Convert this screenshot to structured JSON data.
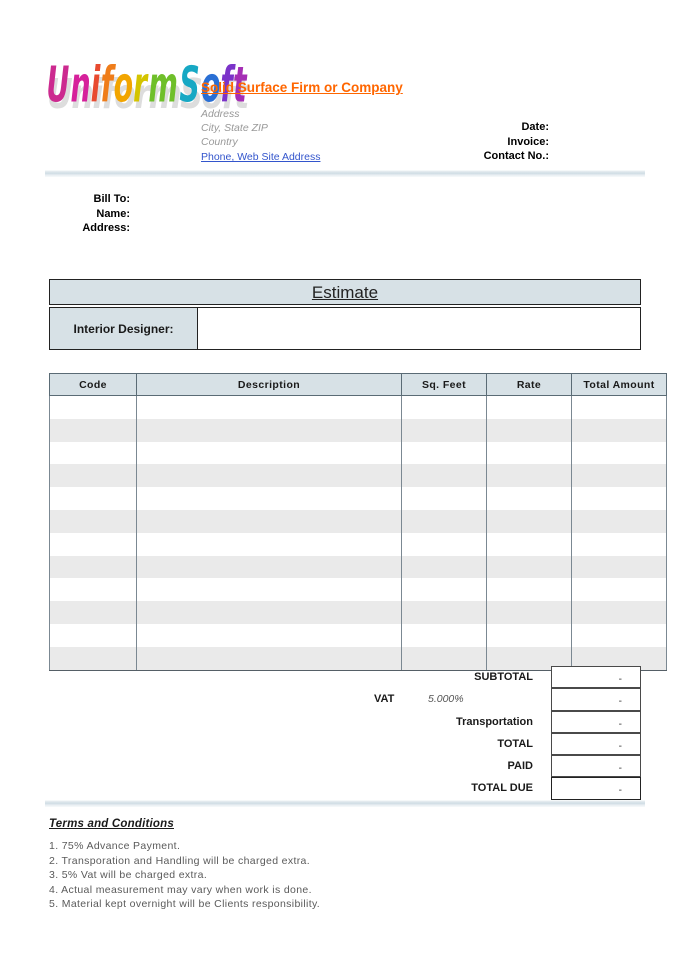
{
  "header": {
    "logo_text": "UniformSoft",
    "logo_letters": [
      {
        "ch": "U",
        "color": "#cc2a8f"
      },
      {
        "ch": "n",
        "color": "#d6219b"
      },
      {
        "ch": "i",
        "color": "#e84a2f"
      },
      {
        "ch": "f",
        "color": "#ef7d1a"
      },
      {
        "ch": "o",
        "color": "#f2a500"
      },
      {
        "ch": "r",
        "color": "#d4c400"
      },
      {
        "ch": "m",
        "color": "#6fbf2a"
      },
      {
        "ch": "S",
        "color": "#17a8c4"
      },
      {
        "ch": "o",
        "color": "#2a6fd4"
      },
      {
        "ch": "f",
        "color": "#7b33c9"
      },
      {
        "ch": "t",
        "color": "#a52fb5"
      }
    ],
    "company_name": "Solid Surface Firm or Company",
    "address_line1": "Address",
    "address_line2": "City, State ZIP",
    "address_line3": "Country",
    "address_line4": "Phone, Web Site Address",
    "meta": {
      "date_label": "Date:",
      "invoice_label": "Invoice:",
      "contact_label": "Contact No.:"
    },
    "company_name_color": "#FF6600",
    "link_color": "#3355cc"
  },
  "bill_to": {
    "title": "Bill To:",
    "name_label": "Name:",
    "address_label": "Address:"
  },
  "estimate": {
    "title": "Estimate",
    "designer_label": "Interior Designer:",
    "designer_value": ""
  },
  "items_table": {
    "columns": [
      "Code",
      "Description",
      "Sq. Feet",
      "Rate",
      "Total Amount"
    ],
    "rows": [
      {
        "code": "",
        "description": "",
        "sq_feet": "",
        "rate": "",
        "total_amount": ""
      },
      {
        "code": "",
        "description": "",
        "sq_feet": "",
        "rate": "",
        "total_amount": ""
      },
      {
        "code": "",
        "description": "",
        "sq_feet": "",
        "rate": "",
        "total_amount": ""
      },
      {
        "code": "",
        "description": "",
        "sq_feet": "",
        "rate": "",
        "total_amount": ""
      },
      {
        "code": "",
        "description": "",
        "sq_feet": "",
        "rate": "",
        "total_amount": ""
      },
      {
        "code": "",
        "description": "",
        "sq_feet": "",
        "rate": "",
        "total_amount": ""
      },
      {
        "code": "",
        "description": "",
        "sq_feet": "",
        "rate": "",
        "total_amount": ""
      },
      {
        "code": "",
        "description": "",
        "sq_feet": "",
        "rate": "",
        "total_amount": ""
      },
      {
        "code": "",
        "description": "",
        "sq_feet": "",
        "rate": "",
        "total_amount": ""
      },
      {
        "code": "",
        "description": "",
        "sq_feet": "",
        "rate": "",
        "total_amount": ""
      },
      {
        "code": "",
        "description": "",
        "sq_feet": "",
        "rate": "",
        "total_amount": ""
      },
      {
        "code": "",
        "description": "",
        "sq_feet": "",
        "rate": "",
        "total_amount": ""
      }
    ]
  },
  "totals": {
    "subtotal_label": "SUBTOTAL",
    "subtotal_value": "-",
    "vat_prefix": "VAT",
    "vat_rate": "5.000%",
    "vat_value": "-",
    "transportation_label": "Transportation",
    "transportation_value": "-",
    "total_label": "TOTAL",
    "total_value": "-",
    "paid_label": "PAID",
    "paid_value": "-",
    "total_due_label": "TOTAL DUE",
    "total_due_value": "-"
  },
  "terms": {
    "title": "Terms and Conditions",
    "items": [
      "1. 75% Advance Payment.",
      "2. Transporation and Handling will be charged extra.",
      "3. 5% Vat will be charged extra.",
      "4. Actual measurement may vary when work is done.",
      "5. Material kept overnight will be Clients responsibility."
    ]
  }
}
